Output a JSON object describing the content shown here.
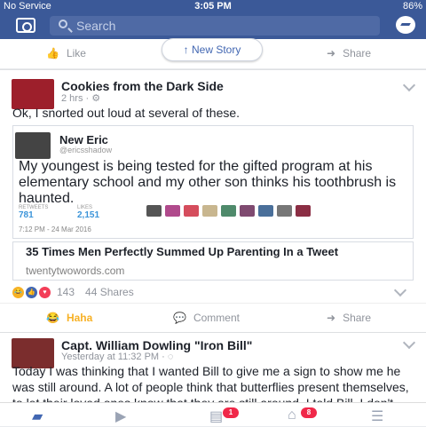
{
  "status_bar": {
    "carrier": "No Service",
    "time": "3:05 PM",
    "battery": "86%"
  },
  "header": {
    "search_placeholder": "Search"
  },
  "top_actions": {
    "like_label": "Like",
    "share_label": "Share",
    "new_story_label": "New Story"
  },
  "post1": {
    "title": "Cookies from the Dark Side",
    "meta": "2 hrs ·",
    "text": "Ok, I snorted out loud at several of these.",
    "tweet": {
      "author": "New Eric",
      "handle": "@ericsshadow",
      "body": "My youngest is being tested for the gifted program at his elementary school and my other son thinks his toothbrush is haunted.",
      "retweets_label": "RETWEETS",
      "likes_label": "LIKES",
      "retweets": "781",
      "likes": "2,151",
      "date": "7:12 PM - 24 Mar 2016"
    },
    "link": {
      "title": "35 Times Men Perfectly Summed Up Parenting In a Tweet",
      "domain": "twentytwowords.com"
    },
    "reaction_count": "143",
    "shares": "44 Shares",
    "actions": {
      "haha": "Haha",
      "comment": "Comment",
      "share": "Share"
    }
  },
  "post2": {
    "title": "Capt. William Dowling \"Iron Bill\"",
    "meta": "Yesterday at 11:32 PM ·",
    "text": "Today I was thinking that I wanted Bill to give me a sign to show me he was still around. A lot of people think that butterflies present themselves, to let their loved ones know that they are still around. I told Bill, I don't want it to be a"
  },
  "bottom_nav": {
    "video_badge": "1",
    "notifications_badge": "8"
  },
  "colors": {
    "brand": "#3b5998",
    "link": "#4267b2",
    "notification": "#f02849"
  }
}
